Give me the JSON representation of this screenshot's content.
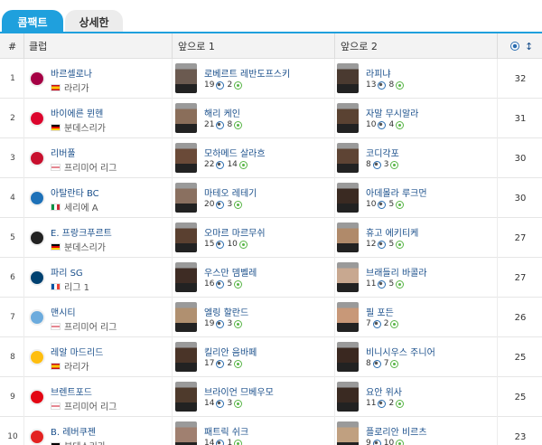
{
  "tabs": [
    {
      "label": "콤팩트",
      "active": true
    },
    {
      "label": "상세한",
      "active": false
    }
  ],
  "header": {
    "rank": "#",
    "club": "클럽",
    "player1": "앞으로 1",
    "player2": "앞으로 2",
    "sort_icon": "↕"
  },
  "colors": {
    "accent": "#1fa0dd",
    "link": "#1a4f8b"
  },
  "rows": [
    {
      "rank": "1",
      "club": "바르셀로나",
      "league": "라리가",
      "crest": "#a50044",
      "flag": "es",
      "p1": {
        "name": "로베르트 레반도프스키",
        "goals": "19",
        "assists": "2",
        "photo": "#6b5a50"
      },
      "p2": {
        "name": "라피냐",
        "goals": "13",
        "assists": "8",
        "photo": "#4a3a30"
      },
      "total": "32"
    },
    {
      "rank": "2",
      "club": "바이에른 뮌헨",
      "league": "분데스리가",
      "crest": "#dc052d",
      "flag": "de",
      "p1": {
        "name": "해리 케인",
        "goals": "21",
        "assists": "8",
        "photo": "#8a6e5a"
      },
      "p2": {
        "name": "자말 무시알라",
        "goals": "10",
        "assists": "4",
        "photo": "#5a4232"
      },
      "total": "31"
    },
    {
      "rank": "3",
      "club": "리버풀",
      "league": "프리미어 리그",
      "crest": "#c8102e",
      "flag": "en",
      "p1": {
        "name": "모하메드 살라흐",
        "goals": "22",
        "assists": "14",
        "photo": "#6a4a38"
      },
      "p2": {
        "name": "코디각포",
        "goals": "8",
        "assists": "3",
        "photo": "#5e4434"
      },
      "total": "30"
    },
    {
      "rank": "4",
      "club": "아탈란타 BC",
      "league": "세리에 A",
      "crest": "#1e71b8",
      "flag": "it",
      "p1": {
        "name": "마테오 레테기",
        "goals": "20",
        "assists": "3",
        "photo": "#8a7060"
      },
      "p2": {
        "name": "아데몰라 루크먼",
        "goals": "10",
        "assists": "5",
        "photo": "#3a2a22"
      },
      "total": "30"
    },
    {
      "rank": "5",
      "club": "E. 프랑크푸르트",
      "league": "분데스리가",
      "crest": "#222222",
      "flag": "de",
      "p1": {
        "name": "오마르 마르무쉬",
        "goals": "15",
        "assists": "10",
        "photo": "#5a4030"
      },
      "p2": {
        "name": "휴고 에키티케",
        "goals": "12",
        "assists": "5",
        "photo": "#b08a6a"
      },
      "total": "27"
    },
    {
      "rank": "6",
      "club": "파리 SG",
      "league": "리그 1",
      "crest": "#004170",
      "flag": "fr",
      "p1": {
        "name": "우스만 뎀벨레",
        "goals": "16",
        "assists": "5",
        "photo": "#3e2c24"
      },
      "p2": {
        "name": "브래들리 바콜라",
        "goals": "11",
        "assists": "5",
        "photo": "#c8a890"
      },
      "total": "27"
    },
    {
      "rank": "7",
      "club": "맨시티",
      "league": "프리미어 리그",
      "crest": "#6cabdd",
      "flag": "en",
      "p1": {
        "name": "엘링 할란드",
        "goals": "19",
        "assists": "3",
        "photo": "#b09070"
      },
      "p2": {
        "name": "필 포든",
        "goals": "7",
        "assists": "2",
        "photo": "#c89878"
      },
      "total": "26"
    },
    {
      "rank": "8",
      "club": "레알 마드리드",
      "league": "라리가",
      "crest": "#febe10",
      "flag": "es",
      "p1": {
        "name": "킬리안 음바페",
        "goals": "17",
        "assists": "2",
        "photo": "#4a3428"
      },
      "p2": {
        "name": "비니시우스 주니어",
        "goals": "8",
        "assists": "7",
        "photo": "#3a2820"
      },
      "total": "25"
    },
    {
      "rank": "9",
      "club": "브렌트포드",
      "league": "프리미어 리그",
      "crest": "#e30613",
      "flag": "en",
      "p1": {
        "name": "브라이언 므베우모",
        "goals": "14",
        "assists": "3",
        "photo": "#4e3a2c"
      },
      "p2": {
        "name": "요안 위사",
        "goals": "11",
        "assists": "2",
        "photo": "#3a2a22"
      },
      "total": "25"
    },
    {
      "rank": "10",
      "club": "B. 레버쿠젠",
      "league": "분데스리가",
      "crest": "#e32221",
      "flag": "de",
      "p1": {
        "name": "패트릭 쉬크",
        "goals": "14",
        "assists": "1",
        "photo": "#a08070"
      },
      "p2": {
        "name": "플로리안 비르츠",
        "goals": "9",
        "assists": "10",
        "photo": "#c0a080"
      },
      "total": "23"
    }
  ]
}
